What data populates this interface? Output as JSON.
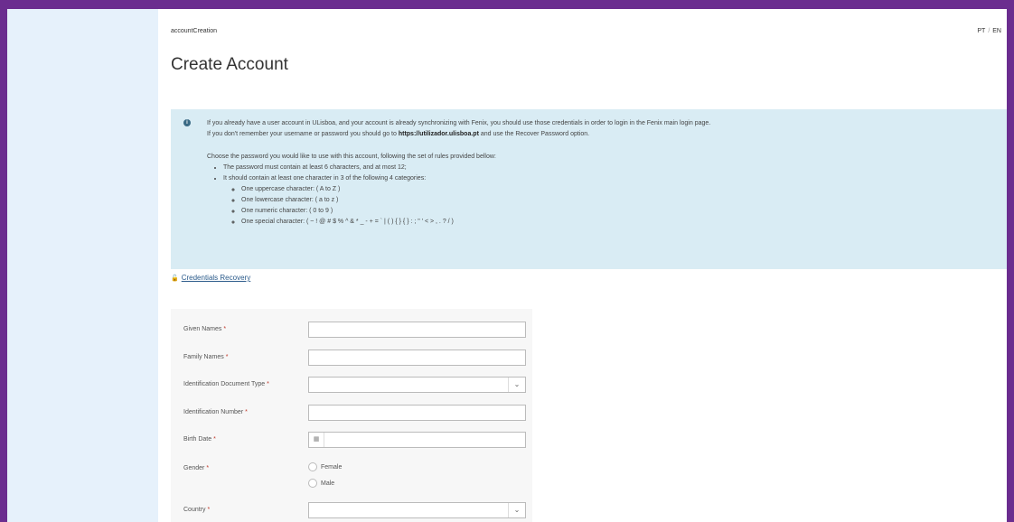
{
  "breadcrumb": "accountCreation",
  "lang": {
    "pt": "PT",
    "sep": "/",
    "en": "EN"
  },
  "page_title": "Create Account",
  "info": {
    "line1": "If you already have a user account in ULisboa, and your account is already synchronizing with Fenix, you should use those credentials in order to login in the Fenix main login page.",
    "line2_pre": "If you don't remember your username or password you should go to ",
    "line2_link": "https://utilizador.ulisboa.pt",
    "line2_post": " and use the Recover Password option.",
    "rules_intro": "Choose the password you would like to use with this account, following the set of rules provided bellow:",
    "rule1": "The password must contain at least 6 characters, and at most 12;",
    "rule2": "It should contain at least one character in 3 of the following 4 categories:",
    "cat1": "One uppercase character: ( A to Z )",
    "cat2": "One lowercase character: ( a to z )",
    "cat3": "One numeric character: ( 0 to 9 )",
    "cat4": "One special character: ( ~ ! @ # $ % ^ & * _ - + = ` | ( ) { } { } : ; \" ' < > , . ? / )"
  },
  "recovery_link": "Credentials Recovery",
  "form": {
    "given_names": "Given Names",
    "family_names": "Family Names",
    "id_doc_type": "Identification Document Type",
    "id_number": "Identification Number",
    "birth_date": "Birth Date",
    "gender": "Gender",
    "gender_female": "Female",
    "gender_male": "Male",
    "country": "Country",
    "required_mark": "*"
  },
  "icons": {
    "info": "info-icon",
    "lock": "lock-icon",
    "calendar": "calendar-icon",
    "chevron": "chevron-down-icon"
  },
  "colors": {
    "frame": "#6b2d8f",
    "sidebar": "#e6f1fb",
    "info_bg": "#d9ecf4",
    "required": "#c0392b",
    "link": "#2a5a8a"
  }
}
